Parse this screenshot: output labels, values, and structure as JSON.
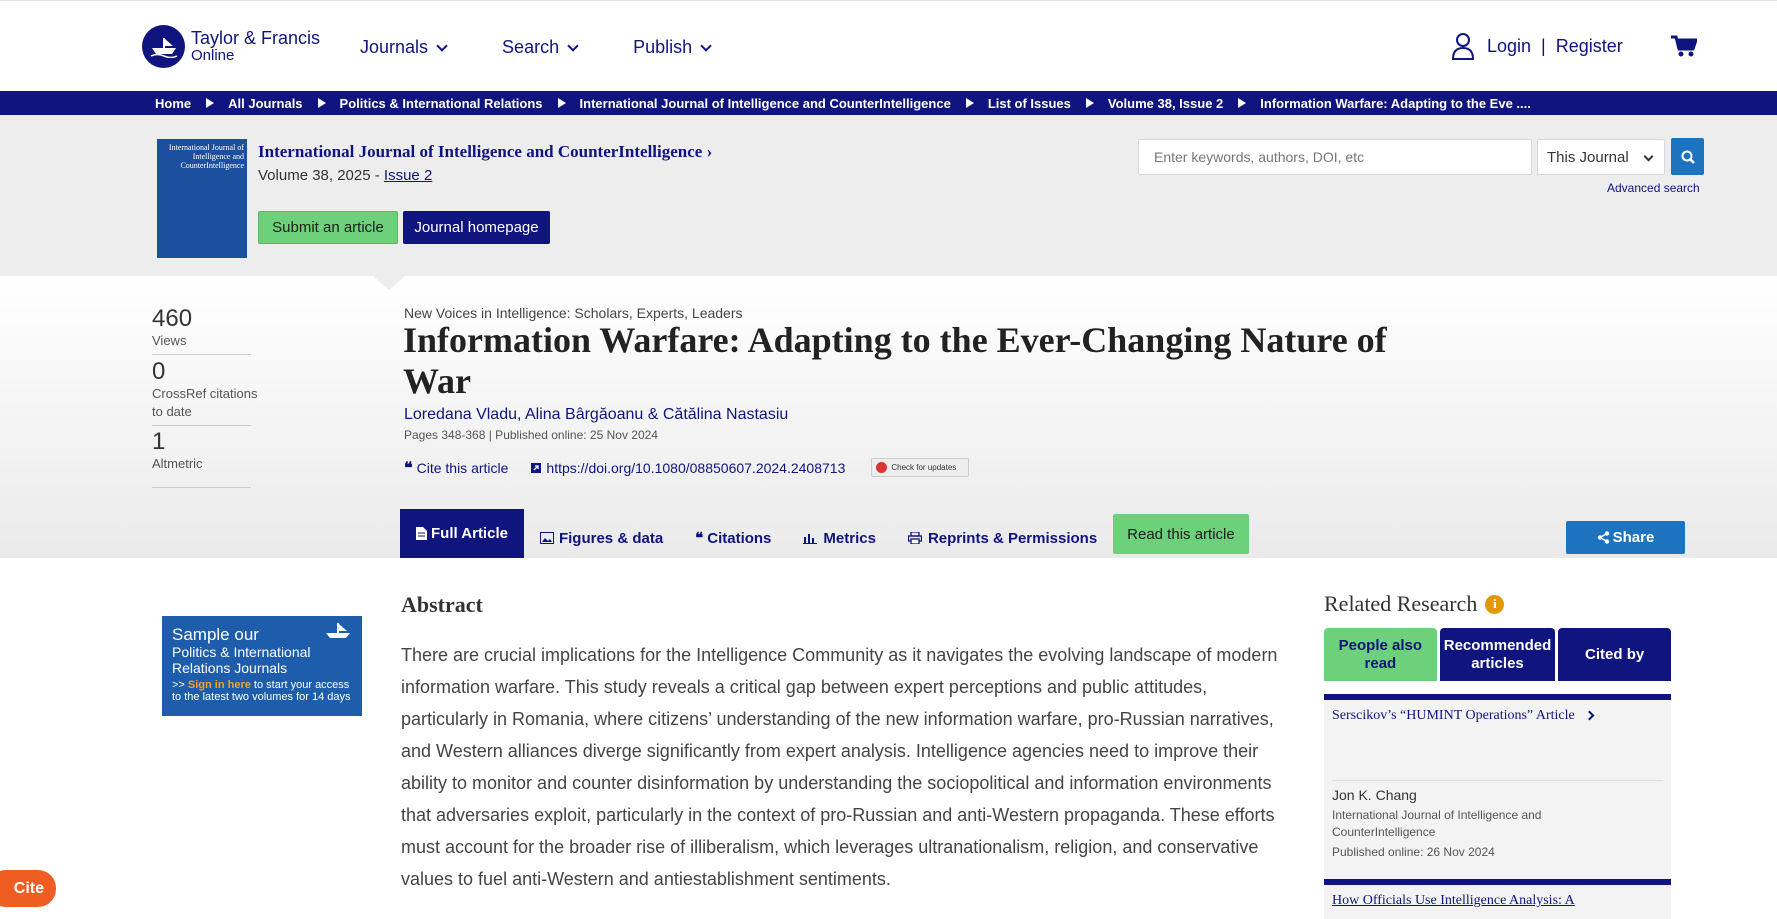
{
  "brand": {
    "line1": "Taylor & Francis",
    "line2": "Online"
  },
  "nav": {
    "journals": "Journals",
    "search": "Search",
    "publish": "Publish"
  },
  "account": {
    "login": "Login",
    "separator": "|",
    "register": "Register"
  },
  "breadcrumb": [
    "Home",
    "All Journals",
    "Politics & International Relations",
    "International Journal of Intelligence and CounterIntelligence",
    "List of Issues",
    "Volume 38, Issue 2",
    "Information Warfare: Adapting to the Eve ...."
  ],
  "journal": {
    "title": "International Journal of Intelligence and CounterIntelligence",
    "title_chevron": "›",
    "volume_text": "Volume 38, 2025 - ",
    "issue_link": "Issue 2",
    "cover_title": "International Journal of Intelligence and CounterIntelligence",
    "submit": "Submit an article",
    "homepage": "Journal homepage"
  },
  "search": {
    "placeholder": "Enter keywords, authors, DOI, etc",
    "scope": "This Journal",
    "advanced": "Advanced search"
  },
  "metrics": [
    {
      "value": "460",
      "label": "Views"
    },
    {
      "value": "0",
      "label": "CrossRef citations to date"
    },
    {
      "value": "1",
      "label": "Altmetric"
    }
  ],
  "article": {
    "kicker": "New Voices in Intelligence: Scholars, Experts, Leaders",
    "title": "Information Warfare: Adapting to the Ever-Changing Nature of War",
    "authors": "Loredana Vladu, Alina Bârgăoanu & Cătălina Nastasiu",
    "pages": "Pages 348-368 | Published online: 25 Nov 2024",
    "cite": "Cite this article",
    "doi": "https://doi.org/10.1080/08850607.2024.2408713",
    "check_updates": "Check for updates"
  },
  "tabs": [
    "Full Article",
    "Figures & data",
    "Citations",
    "Metrics",
    "Reprints & Permissions"
  ],
  "read_article": "Read this article",
  "share": "Share",
  "ad": {
    "line1": "Sample our",
    "line2": "Politics & International Relations Journals",
    "prefix": ">> ",
    "signin": "Sign in here",
    "line3": " to start your access to the latest two volumes for 14 days"
  },
  "abstract": {
    "heading": "Abstract",
    "text": "There are crucial implications for the Intelligence Community as it navigates the evolving landscape of modern information warfare. This study reveals a critical gap between expert perceptions and public attitudes, particularly in Romania, where citizens’ understanding of the new information warfare, pro-Russian narratives, and Western alliances diverge significantly from expert analysis. Intelligence agencies need to improve their ability to monitor and counter disinformation by understanding the sociopolitical and information environments that adversaries exploit, particularly in the context of pro-Russian and anti-Western propaganda. These efforts must account for the broader rise of illiberalism, which leverages ultranationalism, religion, and conservative values to fuel anti-Western and antiestablishment sentiments."
  },
  "related": {
    "heading": "Related Research",
    "tabs": [
      "People also read",
      "Recommended articles",
      "Cited by"
    ],
    "items": [
      {
        "title": "Serscikov’s “HUMINT Operations” Article",
        "author": "Jon K. Chang",
        "journal": "International Journal of Intelligence and CounterIntelligence",
        "published": "Published online: 26 Nov 2024"
      },
      {
        "title": "How Officials Use Intelligence Analysis: A"
      }
    ]
  },
  "cite_button": "Cite",
  "colors": {
    "navy": "#10147e",
    "green": "#6dd07a",
    "blue": "#1e73be",
    "orange": "#f05d23"
  }
}
